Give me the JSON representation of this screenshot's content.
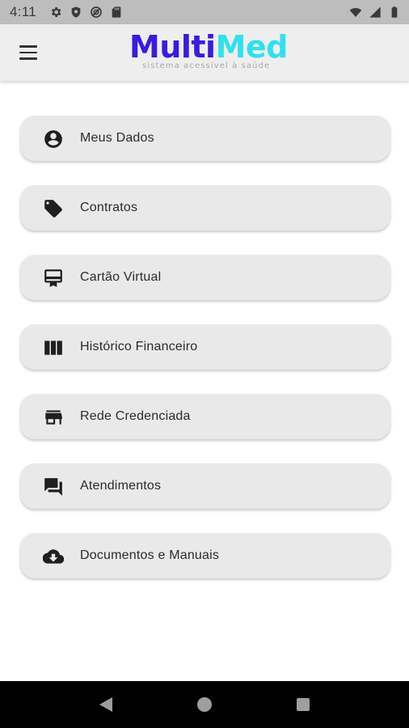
{
  "status_bar": {
    "time": "4:11",
    "left_icons": [
      "settings-icon",
      "shield-icon",
      "vpn-icon",
      "sd-card-icon"
    ],
    "right_icons": [
      "wifi-icon",
      "signal-icon",
      "battery-icon"
    ]
  },
  "app_bar": {
    "menu_icon": "hamburger-menu-icon",
    "logo": {
      "part1": "Multi",
      "part2": "Med",
      "tagline": "sistema acessível à saúde",
      "color1": "#3a1be0",
      "color2": "#2fe1ec"
    }
  },
  "menu": {
    "items": [
      {
        "label": "Meus Dados",
        "icon": "account-circle-icon"
      },
      {
        "label": "Contratos",
        "icon": "tag-icon"
      },
      {
        "label": "Cartão Virtual",
        "icon": "card-membership-icon"
      },
      {
        "label": "Histórico Financeiro",
        "icon": "view-column-icon"
      },
      {
        "label": "Rede Credenciada",
        "icon": "store-icon"
      },
      {
        "label": "Atendimentos",
        "icon": "forum-icon"
      },
      {
        "label": "Documentos e Manuais",
        "icon": "cloud-download-icon"
      }
    ]
  },
  "nav_bar": {
    "buttons": [
      "back-icon",
      "home-icon",
      "recent-apps-icon"
    ]
  }
}
